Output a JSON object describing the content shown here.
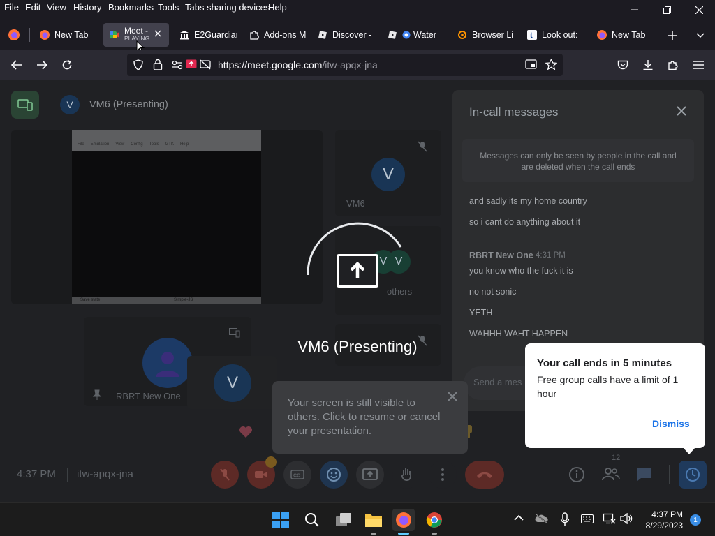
{
  "menubar": {
    "items": [
      "File",
      "Edit",
      "View",
      "History",
      "Bookmarks",
      "Tools",
      "Tabs sharing devices",
      "Help"
    ]
  },
  "tabs": [
    {
      "label": "New Tab",
      "icon": "firefox-icon"
    },
    {
      "label": "Meet -",
      "sublabel": "PLAYING",
      "icon": "google-meet-icon",
      "active": true
    },
    {
      "label": "E2Guardian",
      "icon": "bank-icon"
    },
    {
      "label": "Add-ons M",
      "icon": "puzzle-icon"
    },
    {
      "label": "Discover -",
      "icon": "roblox-icon"
    },
    {
      "label": "Water",
      "icon": "roblox-icon"
    },
    {
      "label": "Browser Li",
      "icon": "settings-fox-icon"
    },
    {
      "label": "Look out:",
      "icon": "t-icon"
    },
    {
      "label": "New Tab",
      "icon": "firefox-icon"
    }
  ],
  "url": {
    "host": "https://meet.google.com",
    "path": "/itw-apqx-jna"
  },
  "meet": {
    "presenter_header": "VM6 (Presenting)",
    "presenter_avatar": "V",
    "tile_vm6_name": "VM6",
    "tile_vm6_avatar": "V",
    "tile_others": "others",
    "others_avatars": [
      "V",
      "V"
    ],
    "tile_rbrt_name": "RBRT New One",
    "self_avatar": "V",
    "shared_menu": [
      "File",
      "Emulation",
      "View",
      "Config",
      "Tools",
      "GTK",
      "Help"
    ],
    "shared_taskbar_left": "Save state",
    "shared_taskbar_right": "Simple-JS",
    "center_title": "VM6 (Presenting)",
    "time": "4:37 PM",
    "meeting_code": "itw-apqx-jna",
    "participants_badge": "12",
    "hand_badge": "1"
  },
  "chat": {
    "title": "In-call messages",
    "notice": "Messages can only be seen by people in the call and are deleted when the call ends",
    "messages_pre": [
      "and sadly its my home country",
      "so i cant do anything about it"
    ],
    "sender": "RBRT New One",
    "sender_time": "4:31 PM",
    "messages": [
      "you know who the fuck it is",
      "no not sonic",
      "YETH",
      "WAHHH WAHT HAPPEN"
    ],
    "input_placeholder": "Send a mes"
  },
  "toast": {
    "title": "Your call ends in 5 minutes",
    "body": "Free group calls have a limit of 1 hour",
    "action": "Dismiss"
  },
  "snackbar": {
    "text": "Your screen is still visible to others. Click to resume or cancel your presentation."
  },
  "taskbar": {
    "time": "4:37 PM",
    "date": "8/29/2023",
    "notification_count": "1"
  },
  "colors": {
    "accent_blue": "#1a73e8",
    "danger_red": "#ea4335",
    "firefox_bg": "#1c1b22"
  }
}
